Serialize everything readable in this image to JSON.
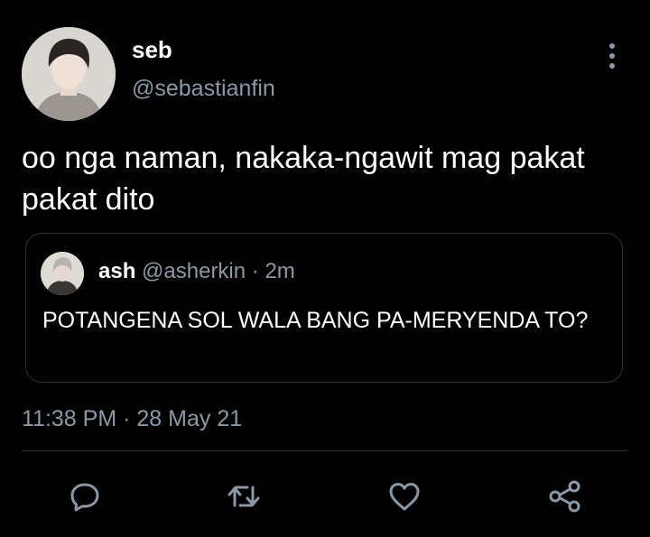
{
  "tweet": {
    "author_name": "seb",
    "author_handle": "@sebastianfin",
    "text": "oo nga naman, nakaka-ngawit mag pakat pakat dito",
    "time": "11:38 PM",
    "separator": "·",
    "date": "28 May 21"
  },
  "quoted": {
    "author_name": "ash",
    "author_handle": "@asherkin",
    "separator": "·",
    "age": "2m",
    "text": "POTANGENA SOL WALA BANG PA-MERYENDA TO?"
  },
  "icons": {
    "more": "more-vertical-icon",
    "reply": "reply-icon",
    "retweet": "retweet-icon",
    "like": "heart-icon",
    "share": "share-icon"
  },
  "colors": {
    "background": "#000000",
    "primary_text": "#ffffff",
    "secondary_text": "#8b98a5",
    "border": "#2f3336"
  }
}
